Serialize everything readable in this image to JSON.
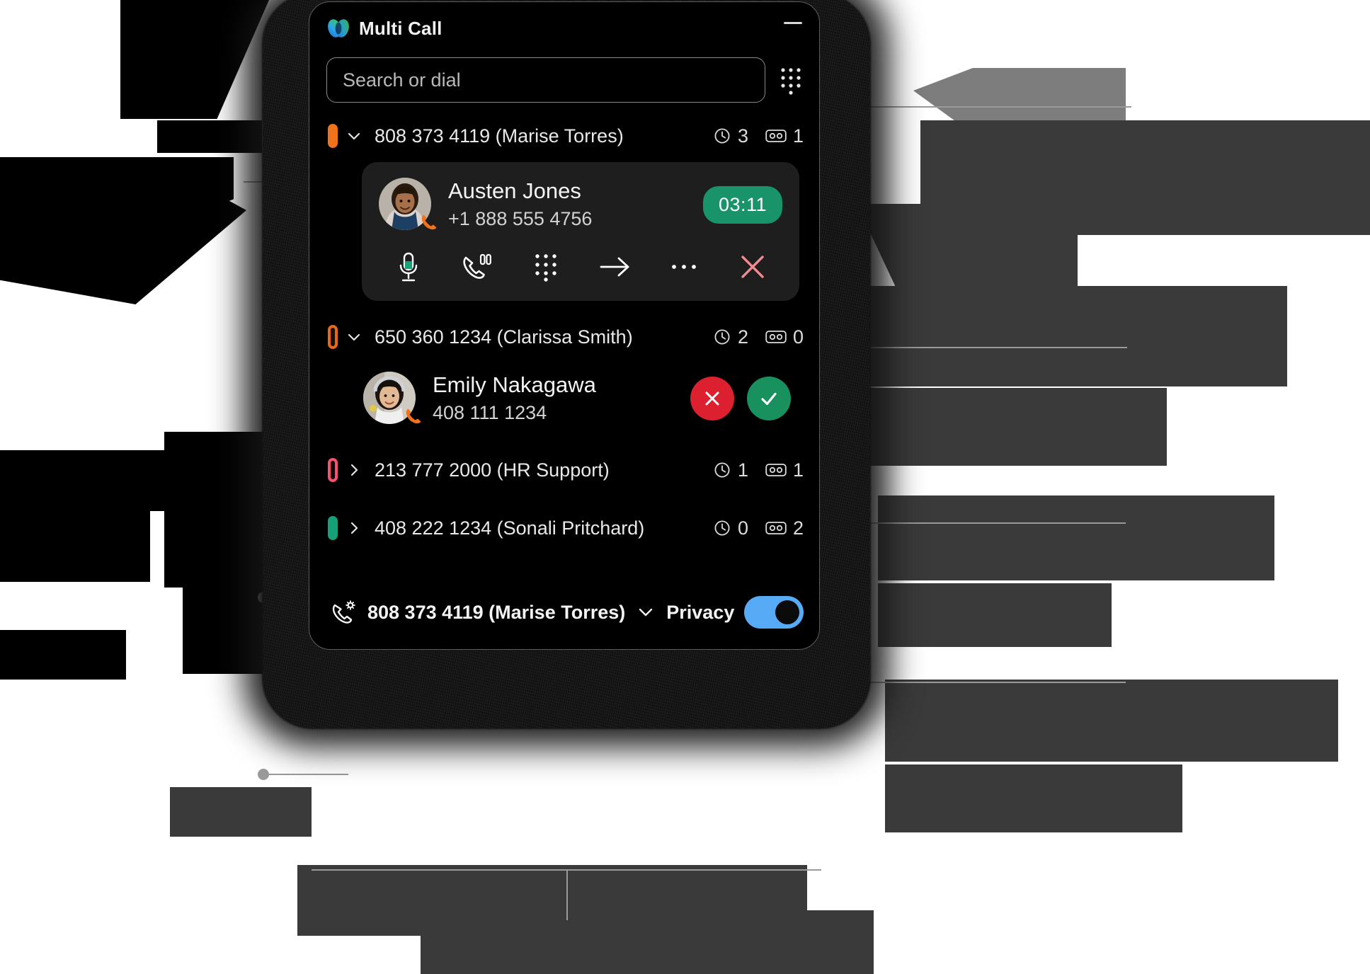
{
  "app": {
    "title": "Multi Call",
    "logo_icon": "multi-call-logo",
    "minimize_label": "Minimize"
  },
  "search": {
    "placeholder": "Search or dial",
    "value": "",
    "keypad_icon": "grid-dots-icon"
  },
  "calls": [
    {
      "line_color": "#f2721c",
      "line_style": "solid",
      "expanded": true,
      "chevron": "chevron-down-icon",
      "label": "808 373 4119 (Marise Torres)",
      "recent_icon": "clock-icon",
      "recent_count": "3",
      "voicemail_icon": "voicemail-icon",
      "voicemail_count": "1",
      "active_call": {
        "name": "Austen Jones",
        "number": "+1 888 555 4756",
        "duration": "03:11",
        "duration_color": "#18936a",
        "avatar": "austen-jones-avatar",
        "phone_badge_icon": "phone-icon",
        "actions": [
          {
            "icon": "microphone-mute-icon",
            "label": "Mute"
          },
          {
            "icon": "call-hold-icon",
            "label": "Hold"
          },
          {
            "icon": "keypad-icon",
            "label": "Keypad"
          },
          {
            "icon": "transfer-arrow-icon",
            "label": "Transfer"
          },
          {
            "icon": "more-ellipsis-icon",
            "label": "More"
          },
          {
            "icon": "end-call-x-icon",
            "label": "End call"
          }
        ]
      }
    },
    {
      "line_color": "#e8681a",
      "line_style": "ring",
      "expanded": true,
      "chevron": "chevron-down-icon",
      "label": "650 360 1234 (Clarissa Smith)",
      "recent_icon": "clock-icon",
      "recent_count": "2",
      "voicemail_icon": "voicemail-icon",
      "voicemail_count": "0",
      "incoming_call": {
        "name": "Emily Nakagawa",
        "number": "408 111 1234",
        "avatar": "emily-nakagawa-avatar",
        "phone_badge_icon": "phone-icon",
        "decline_icon": "decline-x-icon",
        "decline_color": "#dc2030",
        "accept_icon": "accept-check-icon",
        "accept_color": "#18915f"
      }
    },
    {
      "line_color": "#f8516f",
      "line_style": "ring",
      "expanded": false,
      "chevron": "chevron-right-icon",
      "label": "213 777 2000 (HR Support)",
      "recent_icon": "clock-icon",
      "recent_count": "1",
      "voicemail_icon": "voicemail-icon",
      "voicemail_count": "1"
    },
    {
      "line_color": "#16a077",
      "line_style": "solid",
      "expanded": false,
      "chevron": "chevron-right-icon",
      "label": "408 222 1234 (Sonali Pritchard)",
      "recent_icon": "clock-icon",
      "recent_count": "0",
      "voicemail_icon": "voicemail-icon",
      "voicemail_count": "2"
    }
  ],
  "bottom_bar": {
    "line_icon": "phone-settings-icon",
    "active_line": "808 373 4119 (Marise Torres)",
    "line_chevron": "chevron-down-icon",
    "privacy_label": "Privacy",
    "privacy_on": true,
    "privacy_color": "#57aaf5"
  }
}
